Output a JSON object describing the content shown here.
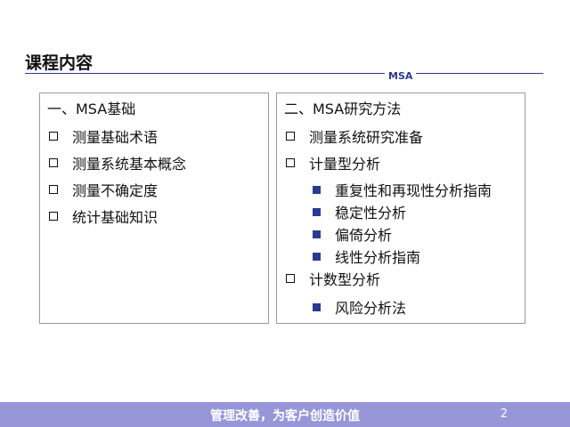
{
  "header": {
    "title": "课程内容",
    "tag": "MSA"
  },
  "left_box": {
    "heading": "一、MSA基础",
    "items": [
      "测量基础术语",
      "测量系统基本概念",
      "测量不确定度",
      "统计基础知识"
    ]
  },
  "right_box": {
    "heading": "二、MSA研究方法",
    "items": [
      {
        "label": "测量系统研究准备",
        "subitems": []
      },
      {
        "label": "计量型分析",
        "subitems": [
          "重复性和再现性分析指南",
          "稳定性分析",
          "偏倚分析",
          "线性分析指南"
        ]
      },
      {
        "label": "计数型分析",
        "subitems": [
          "风险分析法"
        ]
      }
    ]
  },
  "footer": {
    "slogan": "管理改善，为客户创造价值",
    "page_number": "2"
  },
  "colors": {
    "accent": "#2b3a8f",
    "footer_bg": "#9696d8"
  }
}
